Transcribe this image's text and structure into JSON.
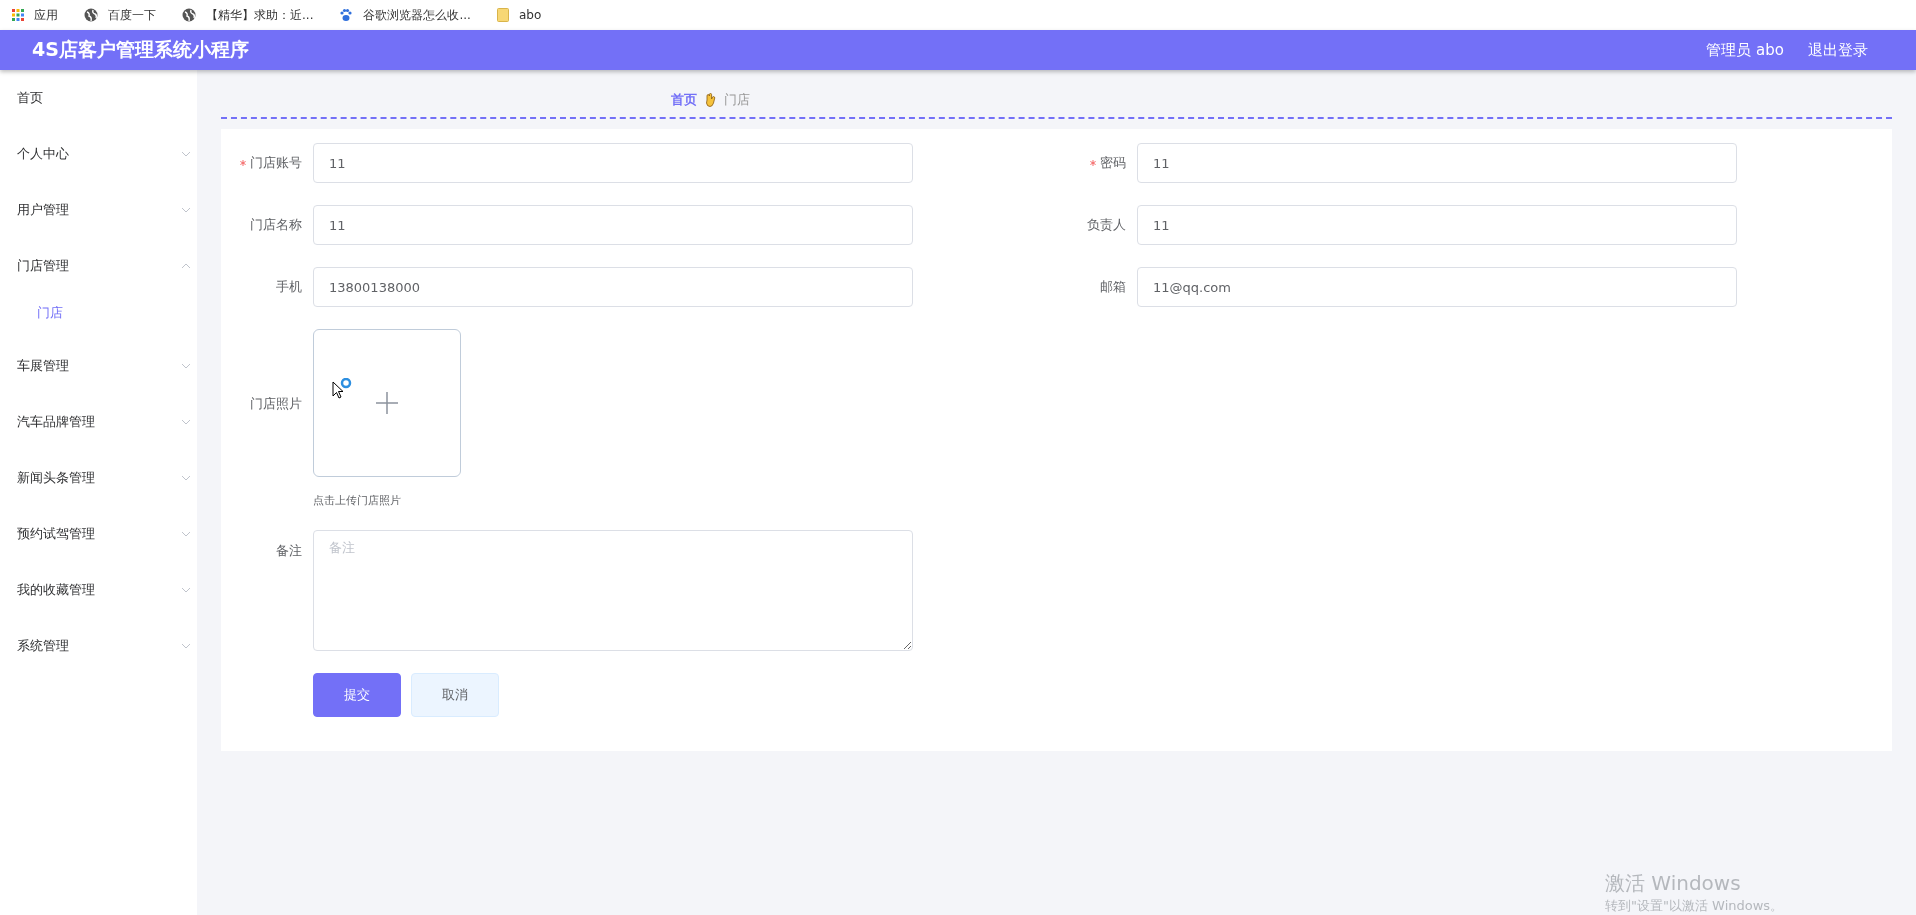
{
  "bookmarks": [
    {
      "kind": "apps",
      "label": "应用"
    },
    {
      "kind": "globe",
      "label": "百度一下"
    },
    {
      "kind": "globe",
      "label": "【精华】求助：近..."
    },
    {
      "kind": "paw",
      "label": "谷歌浏览器怎么收..."
    },
    {
      "kind": "folder",
      "label": "abo"
    }
  ],
  "header": {
    "title": "4S店客户管理系统小程序",
    "user": "管理员 abo",
    "logout": "退出登录"
  },
  "sidebar": {
    "items": [
      {
        "label": "首页"
      },
      {
        "label": "个人中心",
        "expanded": false
      },
      {
        "label": "用户管理",
        "expanded": false
      },
      {
        "label": "门店管理",
        "expanded": true,
        "children": [
          {
            "label": "门店",
            "selected": true
          }
        ]
      },
      {
        "label": "车展管理",
        "expanded": false
      },
      {
        "label": "汽车品牌管理",
        "expanded": false
      },
      {
        "label": "新闻头条管理",
        "expanded": false
      },
      {
        "label": "预约试驾管理",
        "expanded": false
      },
      {
        "label": "我的收藏管理",
        "expanded": false
      },
      {
        "label": "系统管理",
        "expanded": false
      }
    ]
  },
  "breadcrumb": [
    {
      "label": "首页",
      "current": false
    },
    {
      "label": "门店",
      "current": true
    }
  ],
  "form": {
    "fields": [
      {
        "label": "门店账号",
        "value": "11",
        "required": true
      },
      {
        "label": "密码",
        "value": "11",
        "required": true
      },
      {
        "label": "门店名称",
        "value": "11",
        "required": false
      },
      {
        "label": "负责人",
        "value": "11",
        "required": false
      },
      {
        "label": "手机",
        "value": "13800138000",
        "required": false
      },
      {
        "label": "邮箱",
        "value": "11@qq.com",
        "required": false
      }
    ],
    "photo": {
      "label": "门店照片",
      "hint": "点击上传门店照片"
    },
    "remark": {
      "label": "备注",
      "placeholder": "备注"
    },
    "buttons": [
      {
        "kind": "primary",
        "label": "提交"
      },
      {
        "kind": "plain",
        "label": "取消"
      }
    ]
  },
  "activation": {
    "title": "激活 Windows",
    "subtitle": "转到\"设置\"以激活 Windows。"
  }
}
